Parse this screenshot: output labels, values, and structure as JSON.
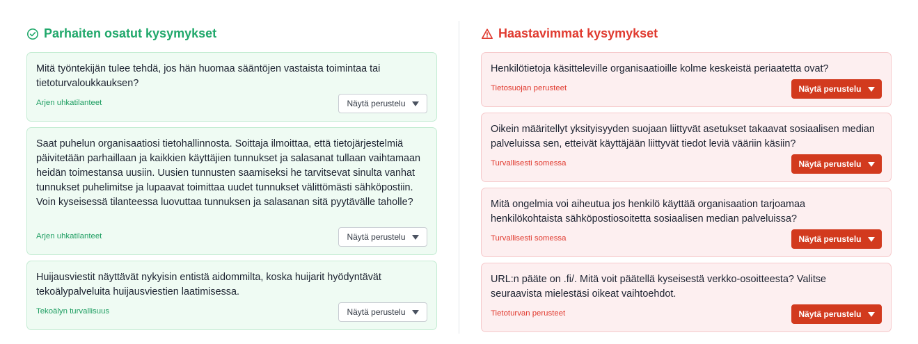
{
  "best": {
    "title": "Parhaiten osatut kysymykset",
    "icon": "check-circle-icon",
    "color": "#20a86b",
    "items": [
      {
        "question": "Mitä työntekijän tulee tehdä, jos hän huomaa sääntöjen vastaista toimintaa tai tietoturvaloukkauksen?",
        "category": "Arjen uhkatilanteet",
        "button": "Näytä perustelu"
      },
      {
        "question": "Saat puhelun organisaatiosi tietohallinnosta. Soittaja ilmoittaa, että tietojärjestelmiä päivitetään parhaillaan ja kaikkien käyttäjien tunnukset ja salasanat tullaan vaihtamaan heidän toimestansa uusiin. Uusien tunnusten saamiseksi he tarvitsevat sinulta vanhat tunnukset puhelimitse ja lupaavat toimittaa uudet tunnukset välittömästi sähköpostiin. Voin kyseisessä tilanteessa luovuttaa tunnuksen ja salasanan sitä pyytävälle taholle?",
        "category": "Arjen uhkatilanteet",
        "button": "Näytä perustelu"
      },
      {
        "question": "Huijausviestit näyttävät nykyisin entistä aidommilta, koska huijarit hyödyntävät tekoälypalveluita huijausviestien laatimisessa.",
        "category": "Tekoälyn turvallisuus",
        "button": "Näytä perustelu"
      }
    ]
  },
  "hardest": {
    "title": "Haastavimmat kysymykset",
    "icon": "warning-triangle-icon",
    "color": "#e03a2f",
    "items": [
      {
        "question": "Henkilötietoja käsitteleville organisaatioille kolme keskeistä periaatetta ovat?",
        "category": "Tietosuojan perusteet",
        "button": "Näytä perustelu"
      },
      {
        "question": "Oikein määritellyt yksityisyyden suojaan liittyvät asetukset takaavat sosiaalisen median palveluissa sen, etteivät käyttäjään liittyvät tiedot leviä vääriin käsiin?",
        "category": "Turvallisesti somessa",
        "button": "Näytä perustelu"
      },
      {
        "question": "Mitä ongelmia voi aiheutua jos henkilö käyttää organisaation tarjoamaa henkilökohtaista sähköpostiosoitetta sosiaalisen median palveluissa?",
        "category": "Turvallisesti somessa",
        "button": "Näytä perustelu"
      },
      {
        "question": "URL:n pääte on .fi/. Mitä voit päätellä kyseisestä verkko-osoitteesta? Valitse seuraavista mielestäsi oikeat vaihtoehdot.",
        "category": "Tietoturvan perusteet",
        "button": "Näytä perustelu"
      }
    ]
  }
}
